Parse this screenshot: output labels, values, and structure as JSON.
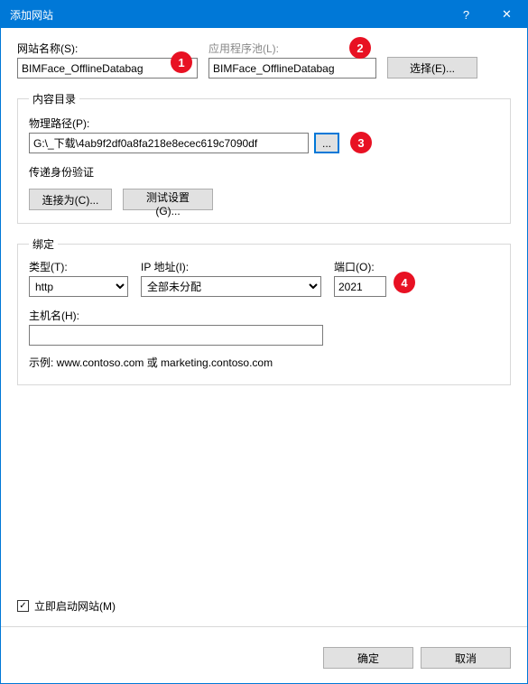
{
  "titlebar": {
    "title": "添加网站",
    "help": "?",
    "close": "✕"
  },
  "site": {
    "name_label": "网站名称(S):",
    "name_value": "BIMFace_OfflineDatabag",
    "apppool_label": "应用程序池(L):",
    "apppool_value": "BIMFace_OfflineDatabag",
    "select_btn": "选择(E)..."
  },
  "content_dir": {
    "legend": "内容目录",
    "path_label": "物理路径(P):",
    "path_value": "G:\\_下载\\4ab9f2df0a8fa218e8ecec619c7090df",
    "browse": "...",
    "auth_label": "传递身份验证",
    "connect_as_btn": "连接为(C)...",
    "test_settings_btn": "测试设置(G)..."
  },
  "binding": {
    "legend": "绑定",
    "type_label": "类型(T):",
    "type_value": "http",
    "ip_label": "IP 地址(I):",
    "ip_value": "全部未分配",
    "port_label": "端口(O):",
    "port_value": "2021",
    "host_label": "主机名(H):",
    "host_value": "",
    "example": "示例: www.contoso.com 或 marketing.contoso.com"
  },
  "start_immediately_label": "立即启动网站(M)",
  "start_immediately_checked": true,
  "footer": {
    "ok": "确定",
    "cancel": "取消"
  },
  "annotations": [
    "1",
    "2",
    "3",
    "4"
  ]
}
